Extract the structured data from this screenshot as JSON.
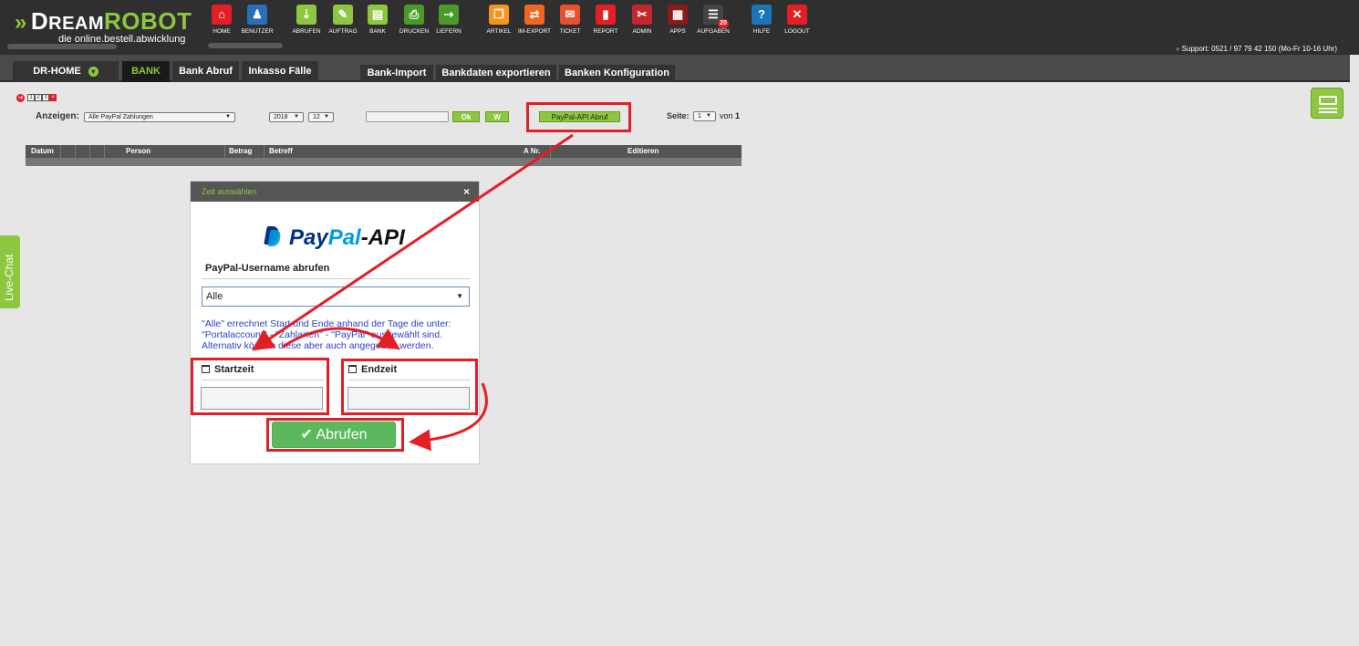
{
  "header": {
    "brand_pre": "D",
    "brand_main": "REAM",
    "brand_robot": "ROBOT",
    "tagline": "die online.bestell.abwicklung",
    "support": "Support: 0521 / 97 79 42 150 (Mo-Fr 10-16 Uhr)",
    "nav": [
      {
        "label": "HOME",
        "icon": "home-icon",
        "color": "#e31e24"
      },
      {
        "label": "BENUTZER",
        "icon": "user-icon",
        "color": "#2a6fb5"
      },
      {
        "label": "ABRUFEN",
        "icon": "download-icon",
        "color": "#8dc63f"
      },
      {
        "label": "AUFTRAG",
        "icon": "order-icon",
        "color": "#8dc63f"
      },
      {
        "label": "BANK",
        "icon": "bank-icon",
        "color": "#8dc63f"
      },
      {
        "label": "DRUCKEN",
        "icon": "print-icon",
        "color": "#4a9a2a"
      },
      {
        "label": "LIEFERN",
        "icon": "delivery-icon",
        "color": "#4a9a2a"
      },
      {
        "label": "ARTIKEL",
        "icon": "article-icon",
        "color": "#f7941d"
      },
      {
        "label": "IM-EXPORT",
        "icon": "import-export-icon",
        "color": "#f26522"
      },
      {
        "label": "TICKET",
        "icon": "mail-icon",
        "color": "#e8502f"
      },
      {
        "label": "REPORT",
        "icon": "report-icon",
        "color": "#e31e24"
      },
      {
        "label": "ADMIN",
        "icon": "tools-icon",
        "color": "#c1272d"
      },
      {
        "label": "APPS",
        "icon": "apps-icon",
        "color": "#8b1a1a"
      },
      {
        "label": "AUFGABEN",
        "icon": "tasks-icon",
        "color": "#444444",
        "badge": "20"
      },
      {
        "label": "HILFE",
        "icon": "help-icon",
        "color": "#1b75bb"
      },
      {
        "label": "LOGOUT",
        "icon": "logout-icon",
        "color": "#e31e24"
      }
    ]
  },
  "tabs": {
    "left": [
      "DR-HOME",
      "BANK",
      "Bank Abruf",
      "Inkasso Fälle"
    ],
    "right": [
      "Bank-Import",
      "Bankdaten exportieren",
      "Banken Konfiguration"
    ]
  },
  "filters": {
    "show_label": "Anzeigen:",
    "show_value": "Alle PayPal Zahlungen",
    "year": "2018",
    "month": "12",
    "ok": "Ok",
    "w": "W",
    "paypal_api": "PayPal-API Abruf",
    "page_label": "Seite:",
    "page_value": "1",
    "page_of": "von",
    "page_total": "1"
  },
  "pager": [
    "1",
    "2",
    "3"
  ],
  "table": {
    "columns": [
      "Datum",
      "Person",
      "Betrag",
      "Betreff",
      "A Nr.",
      "Editieren"
    ]
  },
  "live_chat": "Live-Chat",
  "dialog": {
    "title": "Zeit auswählen",
    "close": "×",
    "logo_pay": "Pay",
    "logo_pal": "Pal",
    "logo_api": "-API",
    "username_label": "PayPal-Username abrufen",
    "username_value": "Alle",
    "note": "\"Alle\" errechnet Start und Ende anhand der Tage die unter: \"Portalaccount\" - \"Zahlarten\" - \"PayPal\" ausgewählt sind. Alternativ können diese aber auch angegeben werden.",
    "start_label": "Startzeit",
    "end_label": "Endzeit",
    "submit": "Abrufen",
    "submit_check": "✔"
  },
  "colors": {
    "accent_green": "#8dc63f",
    "highlight_red": "#e31e24",
    "header_bg": "#2f2f2f"
  }
}
